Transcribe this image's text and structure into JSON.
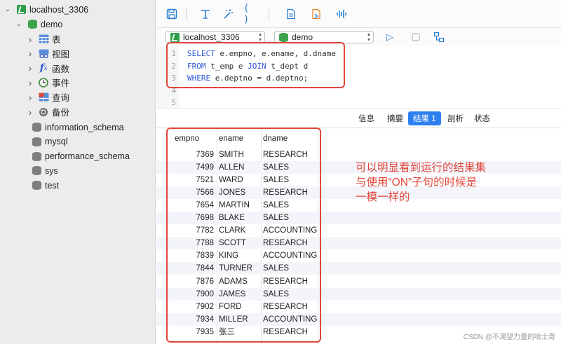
{
  "sidebar": {
    "connection": "localhost_3306",
    "database": "demo",
    "nodes": [
      {
        "label": "表",
        "icon": "table-icon"
      },
      {
        "label": "视图",
        "icon": "view-icon"
      },
      {
        "label": "函数",
        "icon": "function-icon"
      },
      {
        "label": "事件",
        "icon": "event-clock-icon"
      },
      {
        "label": "查询",
        "icon": "query-icon"
      },
      {
        "label": "备份",
        "icon": "backup-icon"
      }
    ],
    "other_databases": [
      "information_schema",
      "mysql",
      "performance_schema",
      "sys",
      "test"
    ]
  },
  "toolbar": {
    "buttons": [
      "save-icon",
      "format-icon",
      "beautify-wand-icon",
      "parentheses-icon",
      "export-icon",
      "explain-icon",
      "profile-icon"
    ]
  },
  "connbar": {
    "connection_select": "localhost_3306",
    "database_select": "demo",
    "run_icon": "run-icon",
    "stop_icon": "stop-icon",
    "schema_icon": "schema-icon"
  },
  "editor": {
    "line_numbers": [
      "1",
      "2",
      "3",
      "4",
      "5"
    ],
    "lines": [
      [
        {
          "t": "SELECT",
          "k": true
        },
        {
          "t": " e.empno, e.ename, d.dname",
          "k": false
        }
      ],
      [
        {
          "t": "FROM",
          "k": true
        },
        {
          "t": " t_emp e ",
          "k": false
        },
        {
          "t": "JOIN",
          "k": true
        },
        {
          "t": " t_dept d",
          "k": false
        }
      ],
      [
        {
          "t": "WHERE",
          "k": true
        },
        {
          "t": " e.deptno = d.deptno;",
          "k": false
        }
      ]
    ]
  },
  "tabs": [
    "信息",
    "摘要",
    "结果 1",
    "剖析",
    "状态"
  ],
  "active_tab": 2,
  "result": {
    "columns": [
      "empno",
      "ename",
      "dname"
    ],
    "rows": [
      [
        "7369",
        "SMITH",
        "RESEARCH"
      ],
      [
        "7499",
        "ALLEN",
        "SALES"
      ],
      [
        "7521",
        "WARD",
        "SALES"
      ],
      [
        "7566",
        "JONES",
        "RESEARCH"
      ],
      [
        "7654",
        "MARTIN",
        "SALES"
      ],
      [
        "7698",
        "BLAKE",
        "SALES"
      ],
      [
        "7782",
        "CLARK",
        "ACCOUNTING"
      ],
      [
        "7788",
        "SCOTT",
        "RESEARCH"
      ],
      [
        "7839",
        "KING",
        "ACCOUNTING"
      ],
      [
        "7844",
        "TURNER",
        "SALES"
      ],
      [
        "7876",
        "ADAMS",
        "RESEARCH"
      ],
      [
        "7900",
        "JAMES",
        "SALES"
      ],
      [
        "7902",
        "FORD",
        "RESEARCH"
      ],
      [
        "7934",
        "MILLER",
        "ACCOUNTING"
      ],
      [
        "7935",
        "张三",
        "RESEARCH"
      ]
    ]
  },
  "annotation": {
    "line1": "可以明显看到运行的结果集",
    "line2": "与使用“ON”子句的时候是",
    "line3": "一模一样的",
    "color": "#e0463a"
  },
  "watermark": "CSDN @不渴望力量的哈士奇"
}
